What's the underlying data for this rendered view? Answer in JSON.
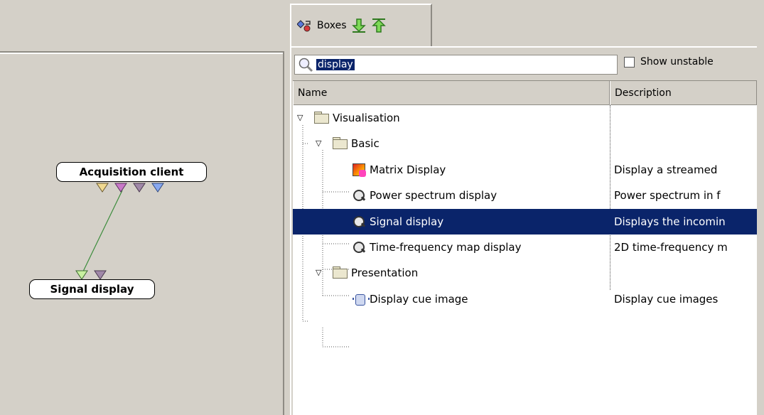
{
  "designer": {
    "boxes": [
      {
        "label": "Acquisition client"
      },
      {
        "label": "Signal display"
      }
    ]
  },
  "box_panel": {
    "tab": {
      "label": "Boxes",
      "icon": "boxes-icon",
      "import_icon": "green-down-arrow-icon",
      "export_icon": "green-up-arrow-icon"
    },
    "search": {
      "value": "display",
      "icon": "search-icon"
    },
    "show_unstable": {
      "label": "Show unstable",
      "checked": false
    },
    "columns": {
      "name": "Name",
      "description": "Description"
    },
    "tree": [
      {
        "label": "Visualisation",
        "desc": "",
        "icon": "folder-icon",
        "expanded": true
      },
      {
        "label": "Basic",
        "desc": "",
        "icon": "folder-icon",
        "expanded": true
      },
      {
        "label": "Matrix Display",
        "desc": "Display a streamed",
        "icon": "matrix-display-icon"
      },
      {
        "label": "Power spectrum display",
        "desc": "Power spectrum in f",
        "icon": "magnifier-icon"
      },
      {
        "label": "Signal display",
        "desc": "Displays the incomin",
        "icon": "magnifier-icon",
        "selected": true
      },
      {
        "label": "Time-frequency map display",
        "desc": "2D time-frequency m",
        "icon": "magnifier-icon"
      },
      {
        "label": "Presentation",
        "desc": "",
        "icon": "folder-icon",
        "expanded": true
      },
      {
        "label": "Display cue image",
        "desc": "Display cue images",
        "icon": "cue-image-icon"
      }
    ]
  },
  "colors": {
    "background": "#d4d0c8",
    "selection": "#0a246a",
    "connector_green": "#c8f0a0",
    "connector_violet": "#c878c8",
    "connector_gray_violet": "#a088a8",
    "connector_blue": "#88a8f0",
    "connector_yellow": "#f0d890",
    "wire": "#3c8c3c"
  }
}
